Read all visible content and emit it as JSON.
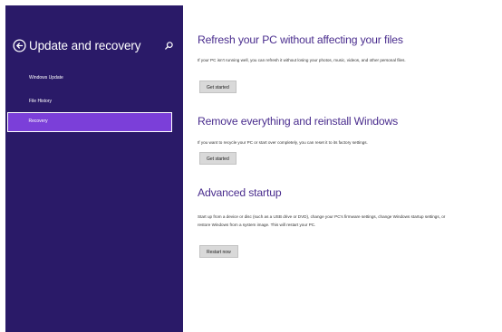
{
  "sidebar": {
    "title": "Update and recovery",
    "items": [
      {
        "label": "Windows Update"
      },
      {
        "label": "File History"
      },
      {
        "label": "Recovery"
      }
    ],
    "active_index": 2,
    "back_icon": "back-arrow-icon",
    "search_icon": "search-icon"
  },
  "sections": [
    {
      "title": "Refresh your PC without affecting your files",
      "description": "If your PC isn't running well, you can refresh it without losing your photos, music, videos, and other personal files.",
      "button_label": "Get started"
    },
    {
      "title": "Remove everything and reinstall Windows",
      "description": "If you want to recycle your PC or start over completely, you can reset it to its factory settings.",
      "button_label": "Get started"
    },
    {
      "title": "Advanced startup",
      "description": "Start up from a device or disc (such as a USB drive or DVD), change your PC's firmware settings, change Windows startup settings, or restore Windows from a system image. This will restart your PC.",
      "button_label": "Restart now"
    }
  ],
  "colors": {
    "sidebar_bg": "#2a1a68",
    "active_item_bg": "#7b3fd9",
    "heading": "#4a2d8e",
    "content_bg": "#ffffff"
  }
}
